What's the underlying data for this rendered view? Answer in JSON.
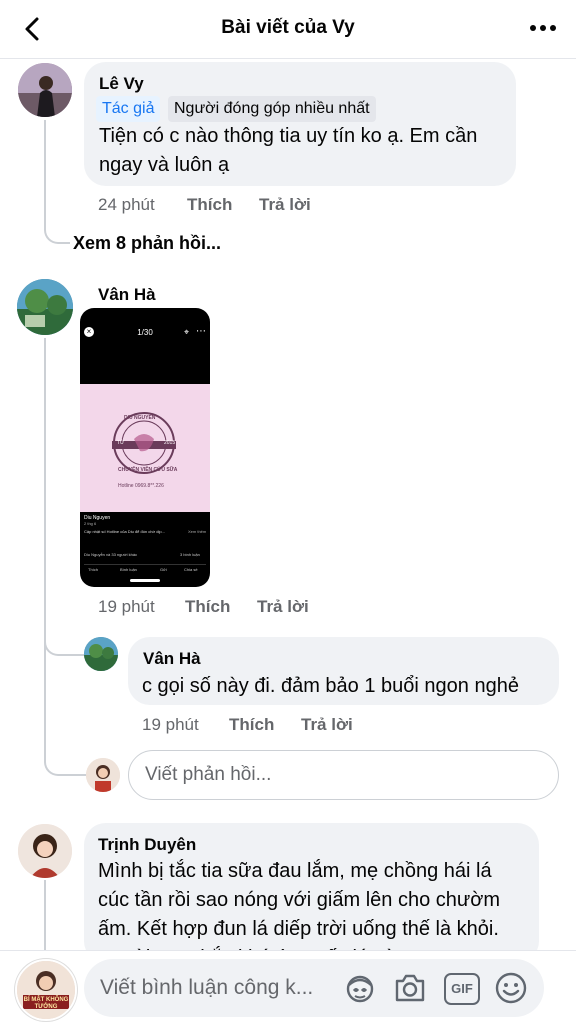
{
  "header": {
    "title": "Bài viết của Vy"
  },
  "comments": [
    {
      "author": "Lê Vy",
      "badges": [
        "Tác giả",
        "Người đóng góp nhiều nhất"
      ],
      "text_lines": [
        "Tiện có c nào thông tia uy tín ko ạ. Em cần",
        "ngay và luôn ạ"
      ],
      "time": "24 phút",
      "like_label": "Thích",
      "reply_label": "Trả lời",
      "view_replies": "Xem 8 phản hồi..."
    },
    {
      "author": "Vân Hà",
      "time": "19 phút",
      "like_label": "Thích",
      "reply_label": "Trả lời",
      "attachment": {
        "counter": "1/30",
        "logo_lines": [
          "DIU NGUYỄN",
          "TỪ",
          "2015",
          "CHUYÊN VIÊN CỨU SỮA"
        ],
        "hotline": "Hotline 0969.8**.226",
        "page_name": "Diu Nguyen",
        "post_date": "2 thg 6",
        "post_text": "Cập nhật số Hotline của Diu để đón chờ dịp...",
        "see_more": "Xem thêm",
        "reactions": "Diu Nguyễn và 33 người khác",
        "comments_count": "3 bình luận",
        "actions": [
          "Thích",
          "Bình luận",
          "Gửi",
          "Chia sẻ"
        ]
      }
    },
    {
      "author": "Vân Hà",
      "text": "c gọi số này đi. đảm bảo 1 buổi ngon nghẻ",
      "time": "19 phút",
      "like_label": "Thích",
      "reply_label": "Trả lời"
    },
    {
      "author": "Trịnh Duyên",
      "text_lines": [
        "Mình bị tắc tia sữa đau lắm, mẹ chồng hái lá",
        "cúc tần rồi sao nóng với giấm lên cho chườm",
        "ấm. Kết hợp đun lá diếp trời uống thế là khỏi.",
        "Ngoài UN chắc khó tìm mấy lá này..."
      ]
    }
  ],
  "reply_input": {
    "placeholder": "Viết phản hồi..."
  },
  "composer": {
    "placeholder": "Viết bình luận công k...",
    "own_avatar_text": "BÍ MẬT KHÔNG TƯỞNG",
    "gif_label": "GIF"
  },
  "colors": {
    "accent": "#1877f2",
    "bubble": "#f0f2f5",
    "secondary_text": "#65676b"
  }
}
